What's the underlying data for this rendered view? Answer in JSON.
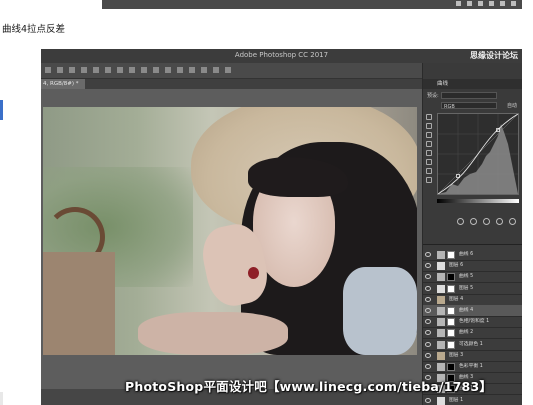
{
  "caption": "曲线4拉点反差",
  "photoshop": {
    "title": "Adobe Photoshop CC 2017",
    "brand_watermark": "思缘设计论坛",
    "brand_watermark_sub": "MISSYUAN.COM",
    "doc_tab": "4, RGB/8#) *"
  },
  "properties": {
    "panel_label": "曲线",
    "preset_label": "预设:",
    "preset_value": "自定",
    "channel_value": "RGB",
    "auto_button": "自动"
  },
  "layers": [
    {
      "name": "曲线 6",
      "kind": "curve",
      "mask": "white"
    },
    {
      "name": "图层 6",
      "kind": "layer",
      "mask": "none"
    },
    {
      "name": "曲线 5",
      "kind": "curve",
      "mask": "black"
    },
    {
      "name": "图层 5",
      "kind": "layer",
      "mask": "white"
    },
    {
      "name": "图层 4",
      "kind": "group",
      "mask": "none"
    },
    {
      "name": "曲线 4",
      "kind": "curve",
      "mask": "white",
      "active": true
    },
    {
      "name": "色相/饱和度 1",
      "kind": "adjust",
      "mask": "white"
    },
    {
      "name": "曲线 2",
      "kind": "curve",
      "mask": "white"
    },
    {
      "name": "可选颜色 1",
      "kind": "adjust",
      "mask": "white"
    },
    {
      "name": "图层 3",
      "kind": "group",
      "mask": "none"
    },
    {
      "name": "色彩平衡 1",
      "kind": "adjust",
      "mask": "black"
    },
    {
      "name": "曲线 3",
      "kind": "curve",
      "mask": "black"
    },
    {
      "name": "曲线 1",
      "kind": "curve",
      "mask": "black"
    },
    {
      "name": "图层 1",
      "kind": "layer",
      "mask": "none"
    }
  ],
  "footer_watermark": "PhotoShop平面设计吧【www.linecg.com/tieba/1783】"
}
